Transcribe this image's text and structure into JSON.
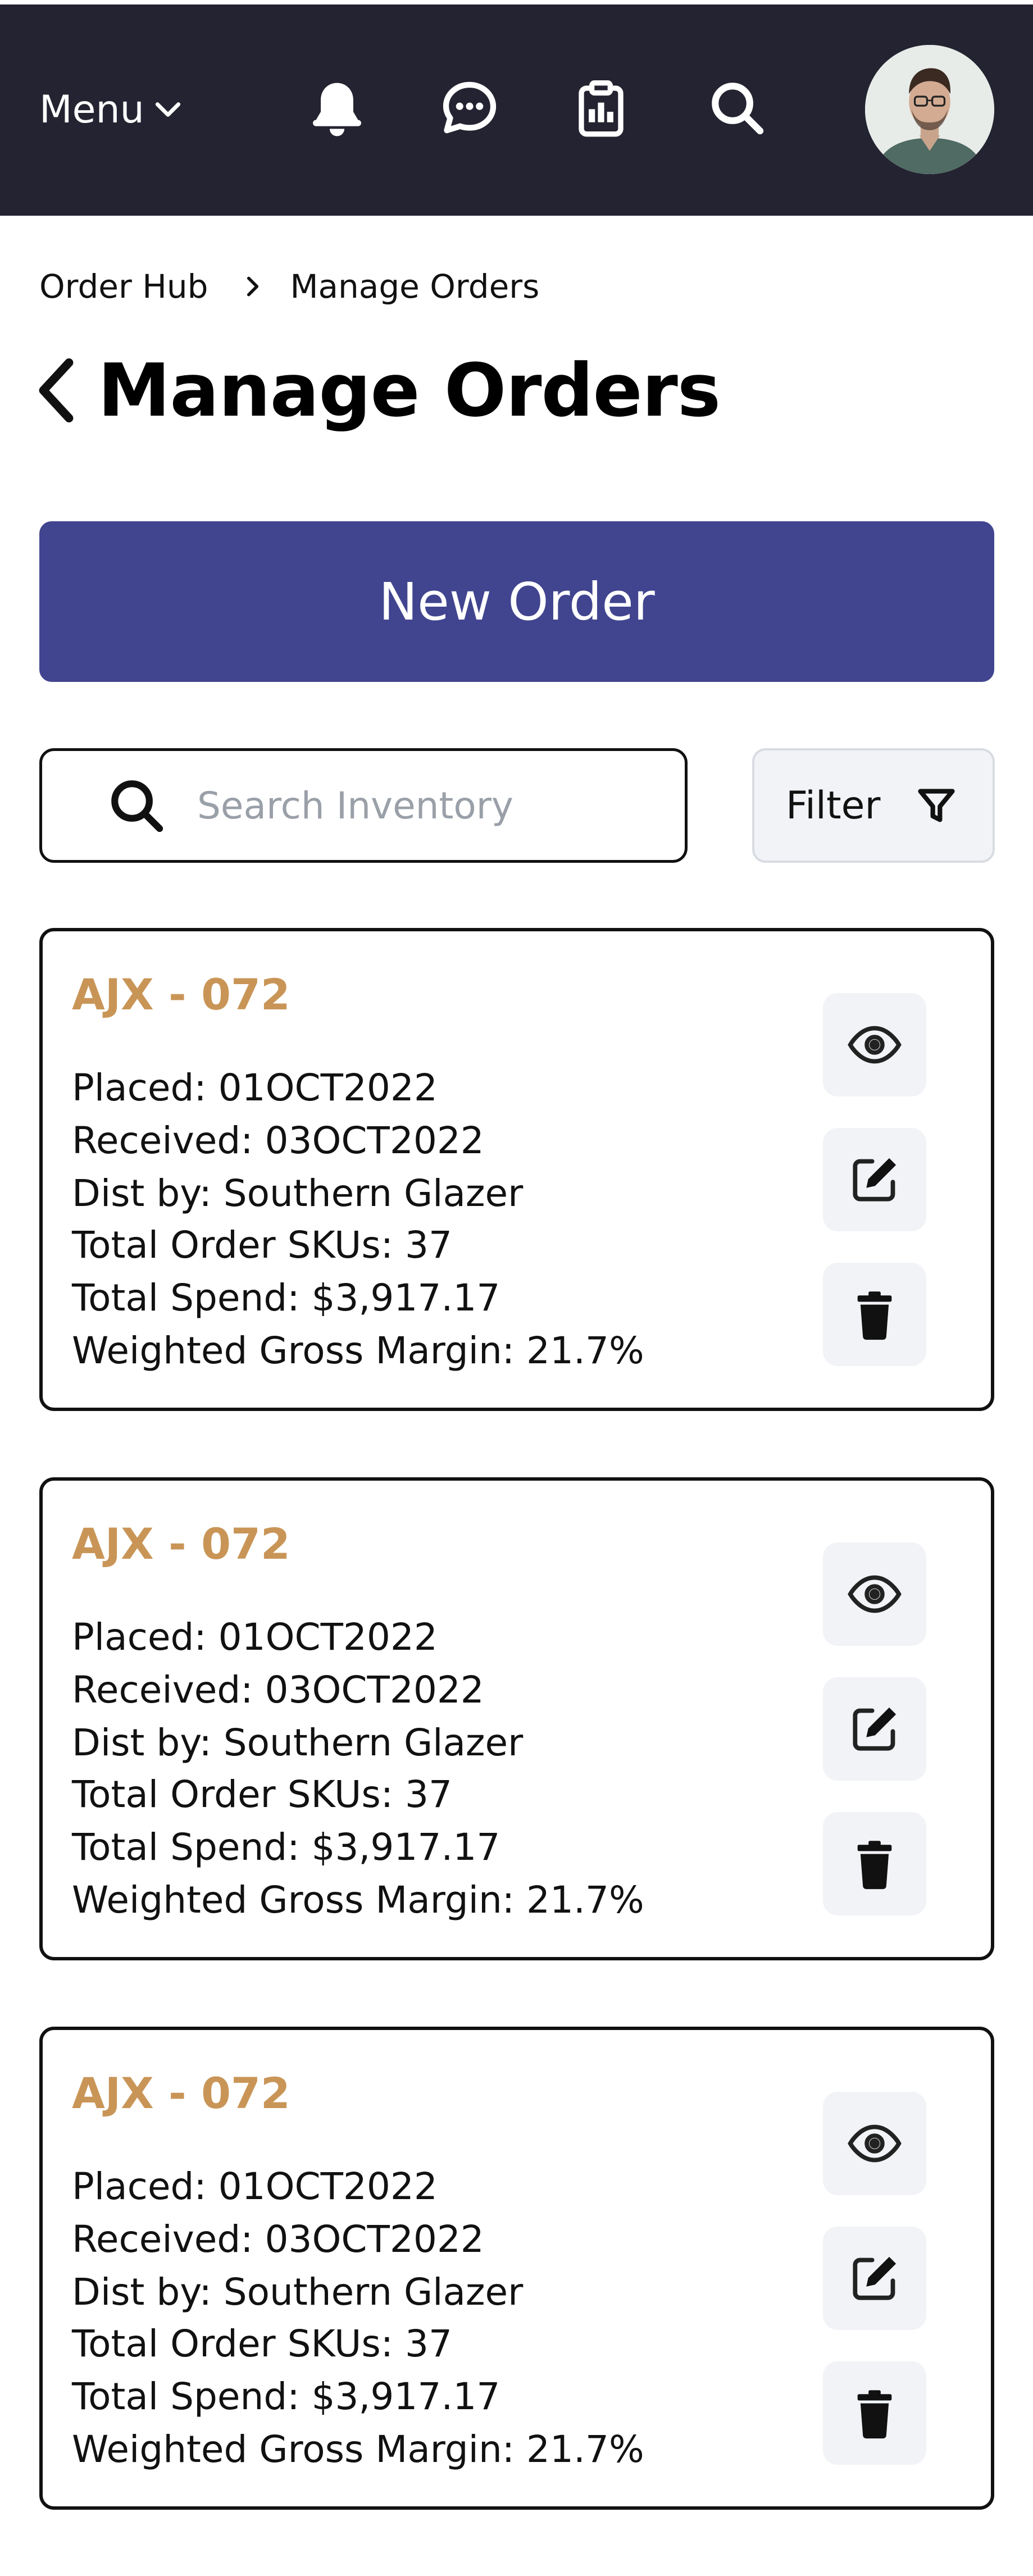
{
  "header": {
    "menu_label": "Menu",
    "icons": [
      "bell-icon",
      "chat-icon",
      "clipboard-icon",
      "search-icon"
    ]
  },
  "breadcrumb": {
    "items": [
      "Order Hub",
      "Manage Orders"
    ]
  },
  "page": {
    "title": "Manage Orders",
    "new_order_label": "New Order",
    "search_placeholder": "Search Inventory",
    "filter_label": "Filter"
  },
  "colors": {
    "header_bg": "#242331",
    "primary_button": "#41458f",
    "order_id": "#c99557",
    "action_bg": "#f1f3f6"
  },
  "orders": [
    {
      "id": "AJX - 072",
      "placed": "Placed: 01OCT2022",
      "received": "Received: 03OCT2022",
      "dist": "Dist by: Southern Glazer",
      "skus": "Total Order SKUs: 37",
      "spend": "Total Spend: $3,917.17",
      "margin": "Weighted Gross Margin: 21.7%"
    },
    {
      "id": "AJX - 072",
      "placed": "Placed: 01OCT2022",
      "received": "Received: 03OCT2022",
      "dist": "Dist by: Southern Glazer",
      "skus": "Total Order SKUs: 37",
      "spend": "Total Spend: $3,917.17",
      "margin": "Weighted Gross Margin: 21.7%"
    },
    {
      "id": "AJX - 072",
      "placed": "Placed: 01OCT2022",
      "received": "Received: 03OCT2022",
      "dist": "Dist by: Southern Glazer",
      "skus": "Total Order SKUs: 37",
      "spend": "Total Spend: $3,917.17",
      "margin": "Weighted Gross Margin: 21.7%"
    }
  ],
  "order_actions": [
    "view-icon",
    "edit-icon",
    "trash-icon"
  ]
}
